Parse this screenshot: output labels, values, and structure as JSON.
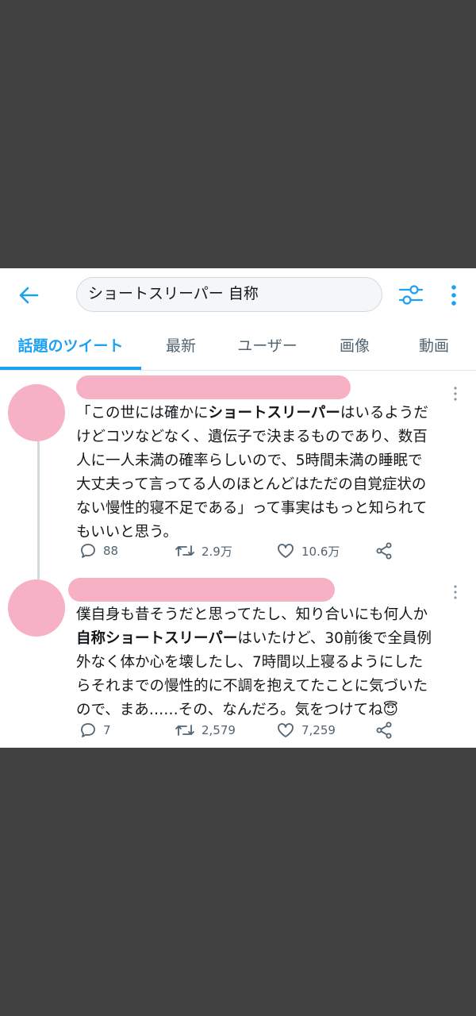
{
  "search": {
    "query": "ショートスリーパー 自称"
  },
  "tabs": [
    {
      "label": "話題のツイート"
    },
    {
      "label": "最新"
    },
    {
      "label": "ユーザー"
    },
    {
      "label": "画像"
    },
    {
      "label": "動画"
    }
  ],
  "tweets": [
    {
      "lines": [
        [
          "「この世には確かに",
          "ショートスリーパー",
          "はいるようだ"
        ],
        [
          "けどコツなどなく、遺伝子で決まるものであり、数百"
        ],
        [
          "人に一人未満の確率らしいので、5時間未満の睡眠で"
        ],
        [
          "大丈夫って言ってる人のほとんどはただの自覚症状の"
        ],
        [
          "ない慢性的寝不足である」って事実はもっと知られて"
        ],
        [
          "もいいと思う。"
        ]
      ],
      "replies": "88",
      "retweets": "2.9万",
      "likes": "10.6万"
    },
    {
      "lines": [
        [
          "僕自身も昔そうだと思ってたし、知り合いにも何人か"
        ],
        [
          "",
          "自称ショートスリーパー",
          "はいたけど、30前後で全員例"
        ],
        [
          "外なく体か心を壊したし、7時間以上寝るようにした"
        ],
        [
          "らそれまでの慢性的に不調を抱えてたことに気づいた"
        ],
        [
          "ので、まあ……その、なんだろ。気をつけてね😇"
        ]
      ],
      "replies": "7",
      "retweets": "2,579",
      "likes": "7,259"
    }
  ],
  "colors": {
    "accent": "#1da1f2",
    "redaction": "#f7b1c4"
  },
  "icons": [
    "back-arrow-icon",
    "filter-icon",
    "more-vertical-icon",
    "reply-icon",
    "retweet-icon",
    "like-icon",
    "share-icon",
    "chevron-down-icon"
  ]
}
